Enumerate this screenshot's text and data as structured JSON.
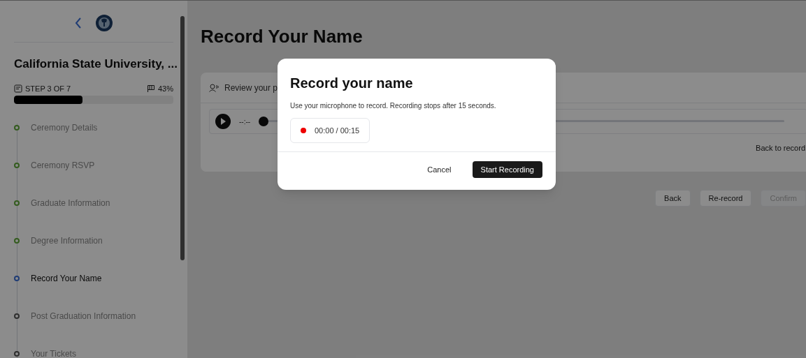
{
  "sidebar": {
    "school": "California State University, ...",
    "step_label": "STEP 3 OF 7",
    "percent": "43%",
    "progress": {
      "level": 0.43
    },
    "steps": [
      {
        "label": "Ceremony Details",
        "completed": true,
        "selected": false
      },
      {
        "label": "Ceremony RSVP",
        "completed": true,
        "selected": false
      },
      {
        "label": "Graduate Information",
        "completed": true,
        "selected": false
      },
      {
        "label": "Degree Information",
        "completed": true,
        "selected": false
      },
      {
        "label": "Record Your Name",
        "completed": false,
        "selected": true
      },
      {
        "label": "Post Graduation Information",
        "completed": false,
        "selected": false
      },
      {
        "label": "Your Tickets",
        "completed": false,
        "selected": false
      }
    ]
  },
  "page": {
    "title": "Record Your Name",
    "card": {
      "header": "Review your p",
      "time": "--:--",
      "seek": {
        "level": 0.0
      },
      "link": "Back to record"
    },
    "buttons": [
      {
        "label": "Back",
        "disabled": false
      },
      {
        "label": "Re-record",
        "disabled": false
      },
      {
        "label": "Confirm",
        "disabled": true
      }
    ]
  },
  "dialog": {
    "title": "Record your name",
    "description": "Use your microphone to record. Recording stops after 15 seconds.",
    "timer": "00:00 / 00:15",
    "recording": false,
    "cancel": "Cancel",
    "confirm": "Start Recording"
  }
}
